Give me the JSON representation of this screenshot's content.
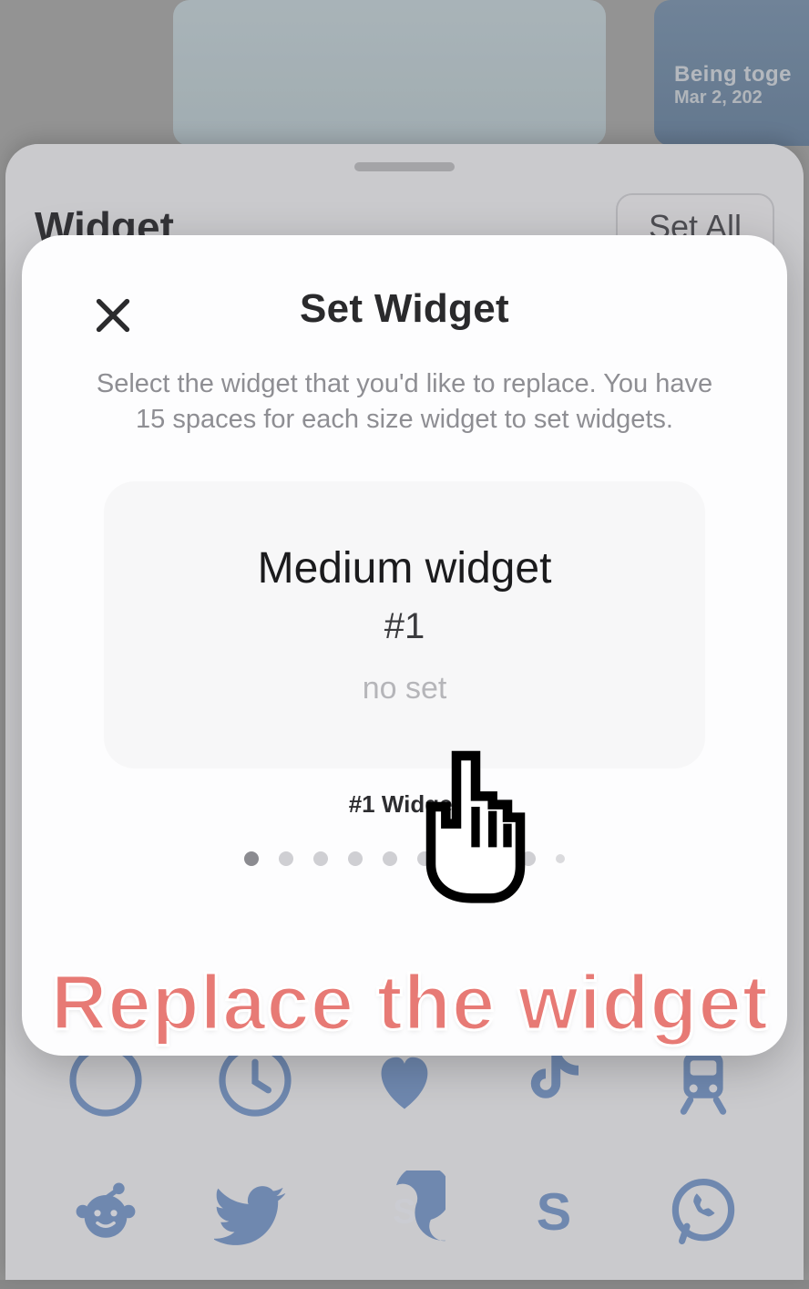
{
  "background_card2": {
    "line1": "Being toge",
    "line2": "Mar 2, 202"
  },
  "sheet1": {
    "title": "Widget",
    "set_all_label": "Set All"
  },
  "modal": {
    "title": "Set Widget",
    "description": "Select the widget that you'd like to replace. You have 15 spaces for each size widget to set widgets.",
    "card": {
      "size_label": "Medium widget",
      "number": "#1",
      "status": "no set"
    },
    "caption": "#1 Widget",
    "page_count": 10,
    "active_page": 0
  },
  "overlay_caption": "Replace the widget",
  "icons": {
    "row1": [
      "safari-icon",
      "clock-icon",
      "heart-icon",
      "tiktok-icon",
      "train-icon"
    ],
    "row2": [
      "reddit-icon",
      "twitter-icon",
      "skype-icon",
      "letter-s-icon",
      "whatsapp-icon"
    ]
  }
}
